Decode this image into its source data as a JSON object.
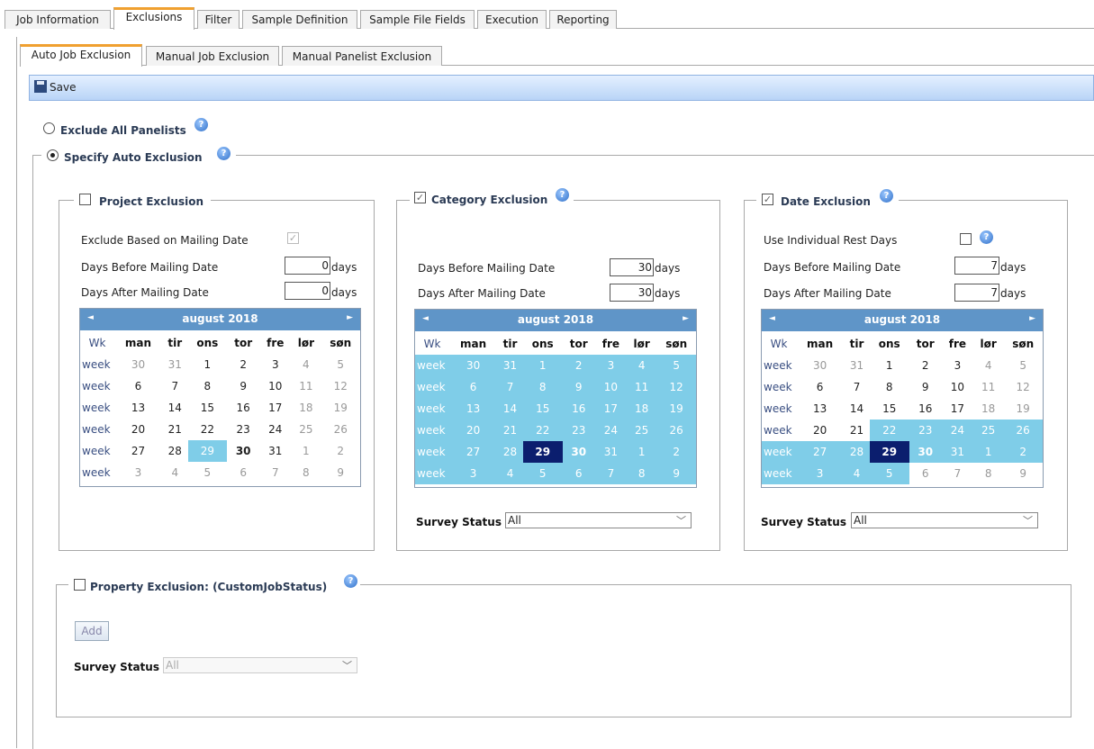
{
  "main_tabs": [
    "Job Information",
    "Exclusions",
    "Filter",
    "Sample Definition",
    "Sample File Fields",
    "Execution",
    "Reporting"
  ],
  "sub_tabs": [
    "Auto Job Exclusion",
    "Manual Job Exclusion",
    "Manual Panelist Exclusion"
  ],
  "toolbar": {
    "save_label": "Save"
  },
  "radios": {
    "exclude_all": "Exclude All Panelists",
    "specify_auto": "Specify Auto Exclusion"
  },
  "project": {
    "title": "Project Exclusion",
    "exclude_based": "Exclude Based on Mailing Date",
    "days_before_label": "Days Before Mailing Date",
    "days_after_label": "Days After Mailing Date",
    "days_before": "0",
    "days_after": "0",
    "days_unit": "days"
  },
  "category": {
    "title": "Category Exclusion",
    "days_before_label": "Days Before Mailing Date",
    "days_after_label": "Days After Mailing Date",
    "days_before": "30",
    "days_after": "30",
    "days_unit": "days",
    "survey_status_label": "Survey Status",
    "survey_status_value": "All"
  },
  "date": {
    "title": "Date Exclusion",
    "use_individual": "Use Individual Rest Days",
    "days_before_label": "Days Before Mailing Date",
    "days_after_label": "Days After Mailing Date",
    "days_before": "7",
    "days_after": "7",
    "days_unit": "days",
    "survey_status_label": "Survey Status",
    "survey_status_value": "All"
  },
  "property": {
    "title": "Property Exclusion: (CustomJobStatus)",
    "add_label": "Add",
    "survey_status_label": "Survey Status",
    "survey_status_value": "All"
  },
  "calendar": {
    "month": "august 2018",
    "wk_label": "Wk",
    "week_label": "week",
    "days": [
      "man",
      "tir",
      "ons",
      "tor",
      "fre",
      "lør",
      "søn"
    ],
    "weeks": [
      [
        "30",
        "31",
        "1",
        "2",
        "3",
        "4",
        "5"
      ],
      [
        "6",
        "7",
        "8",
        "9",
        "10",
        "11",
        "12"
      ],
      [
        "13",
        "14",
        "15",
        "16",
        "17",
        "18",
        "19"
      ],
      [
        "20",
        "21",
        "22",
        "23",
        "24",
        "25",
        "26"
      ],
      [
        "27",
        "28",
        "29",
        "30",
        "31",
        "1",
        "2"
      ],
      [
        "3",
        "4",
        "5",
        "6",
        "7",
        "8",
        "9"
      ]
    ]
  },
  "icons": {
    "help": "help-icon",
    "prev": "prev-month-icon",
    "next": "next-month-icon",
    "save": "floppy-disk-icon",
    "dropdown": "chevron-down-icon"
  }
}
